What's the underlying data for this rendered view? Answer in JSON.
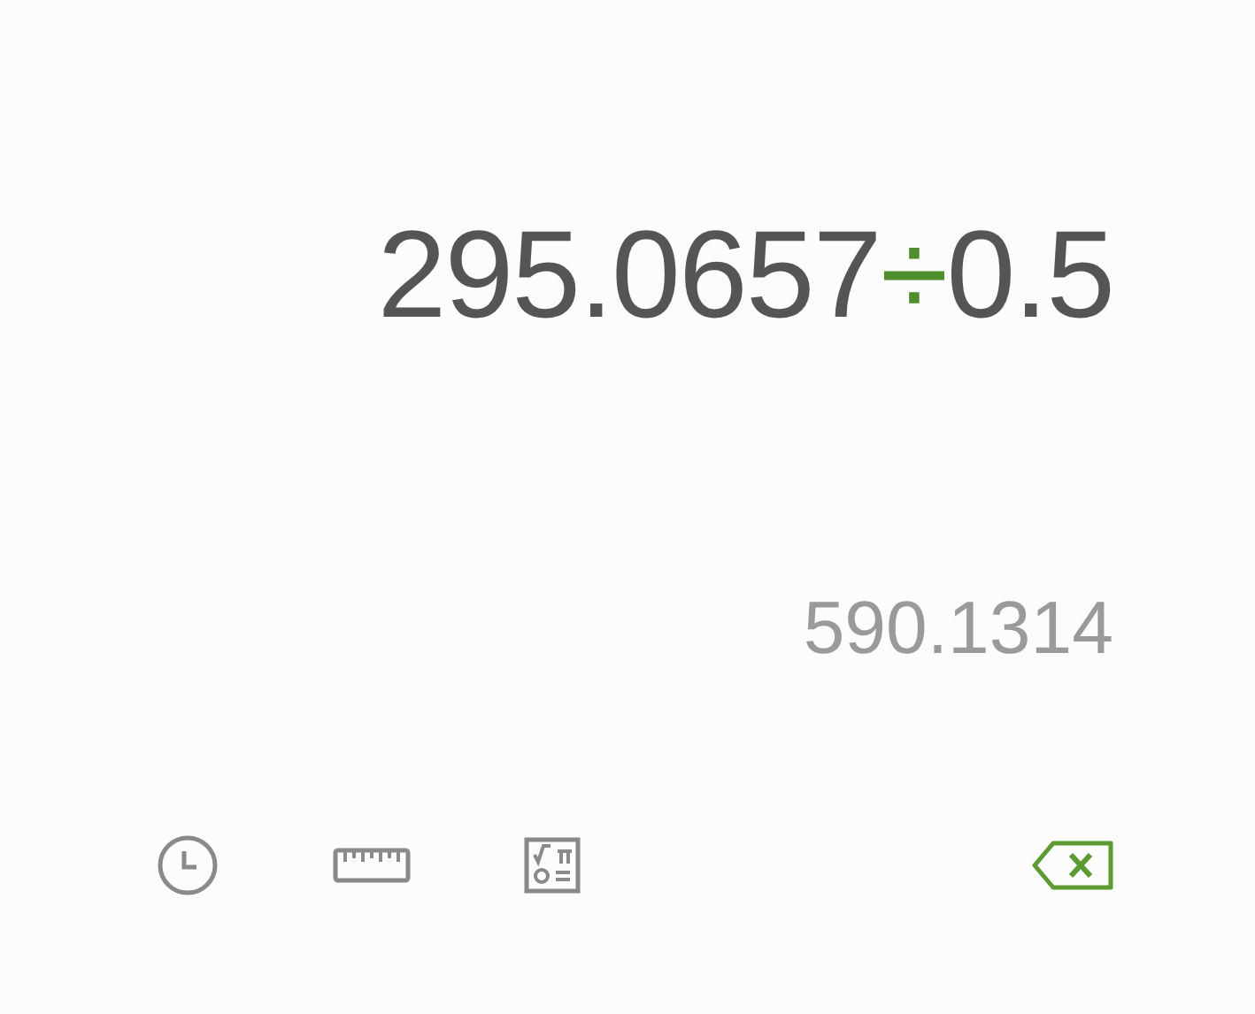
{
  "expression": [
    {
      "kind": "number",
      "text": "295.0657"
    },
    {
      "kind": "operator",
      "text": "÷"
    },
    {
      "kind": "number",
      "text": "0.5"
    }
  ],
  "result": "590.1314",
  "toolbar": [
    {
      "kind": "history"
    },
    {
      "kind": "converter"
    },
    {
      "kind": "scientific"
    },
    {
      "kind": "backspace"
    }
  ]
}
